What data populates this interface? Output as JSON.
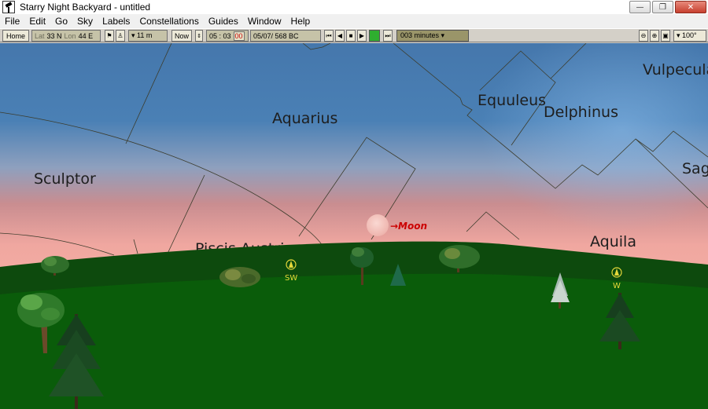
{
  "window": {
    "title": "Starry Night Backyard - untitled"
  },
  "window_controls": {
    "minimize": "—",
    "restore": "❐",
    "close": "✕"
  },
  "menu": [
    "File",
    "Edit",
    "Go",
    "Sky",
    "Labels",
    "Constellations",
    "Guides",
    "Window",
    "Help"
  ],
  "toolbar": {
    "home": "Home",
    "lat_label": "Lat",
    "lat_value": "33 N",
    "lon_label": "Lon",
    "lon_value": "44 E",
    "elevation": "▾ 11 m",
    "now": "Now",
    "time": "05 : 03",
    "time_seconds": "00",
    "date": "05/07/   568 BC",
    "timestep": "003 minutes ▾",
    "fov": "▾ 100°"
  },
  "sky": {
    "constellations": [
      "Aquarius",
      "Equuleus",
      "Delphinus",
      "Vulpecula",
      "Sculptor",
      "Piscis Austrinus",
      "Aquila",
      "Sagitta"
    ],
    "moon_label": "→Moon",
    "compass": [
      {
        "name": "southwest-marker",
        "label": "SW"
      },
      {
        "name": "west-marker",
        "label": "W"
      }
    ],
    "colors": {
      "sky_top": "#4a80b5",
      "sky_mid": "#c08a8c",
      "horizon_glow": "#f0a7a0",
      "ground_dark": "#0d4a0d",
      "ground": "#0b5e0b",
      "boundary_lines": "#3c3c2c",
      "moon": "#f4c6c0"
    }
  }
}
